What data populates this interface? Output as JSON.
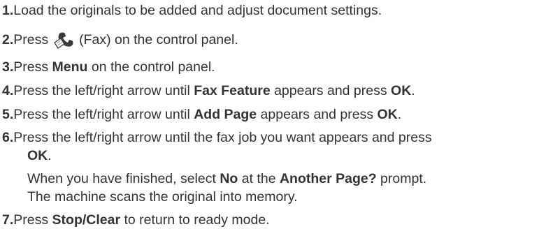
{
  "steps": [
    {
      "num": "1.",
      "text": "Load the originals to be added and adjust document settings."
    },
    {
      "num": "2.",
      "pre": "Press",
      "icon": "fax-phone-icon",
      "post": "(Fax) on the control panel."
    },
    {
      "num": "3.",
      "pre": "Press ",
      "bold1": "Menu",
      "post": " on the control panel."
    },
    {
      "num": "4.",
      "pre": "Press the left/right arrow until ",
      "bold1": "Fax Feature",
      "mid": " appears and press ",
      "bold2": "OK",
      "post": "."
    },
    {
      "num": "5.",
      "pre": "Press the left/right arrow until ",
      "bold1": "Add Page",
      "mid": " appears and press ",
      "bold2": "OK",
      "post": "."
    },
    {
      "num": "6.",
      "line1": "Press the left/right arrow until the fax job you want appears and press",
      "bold_ok": "OK",
      "post": ".",
      "note_pre": "When you have finished, select ",
      "note_bold1": "No",
      "note_mid": " at the ",
      "note_bold2": "Another Page?",
      "note_post": " prompt.",
      "note_line2": "The machine scans the original into memory."
    },
    {
      "num": "7.",
      "pre": "Press ",
      "bold1": "Stop/Clear",
      "post": " to return to ready mode."
    }
  ],
  "colors": {
    "text": "#333333",
    "icon_dark": "#3a3a3a",
    "icon_light": "#9a9a9a"
  }
}
